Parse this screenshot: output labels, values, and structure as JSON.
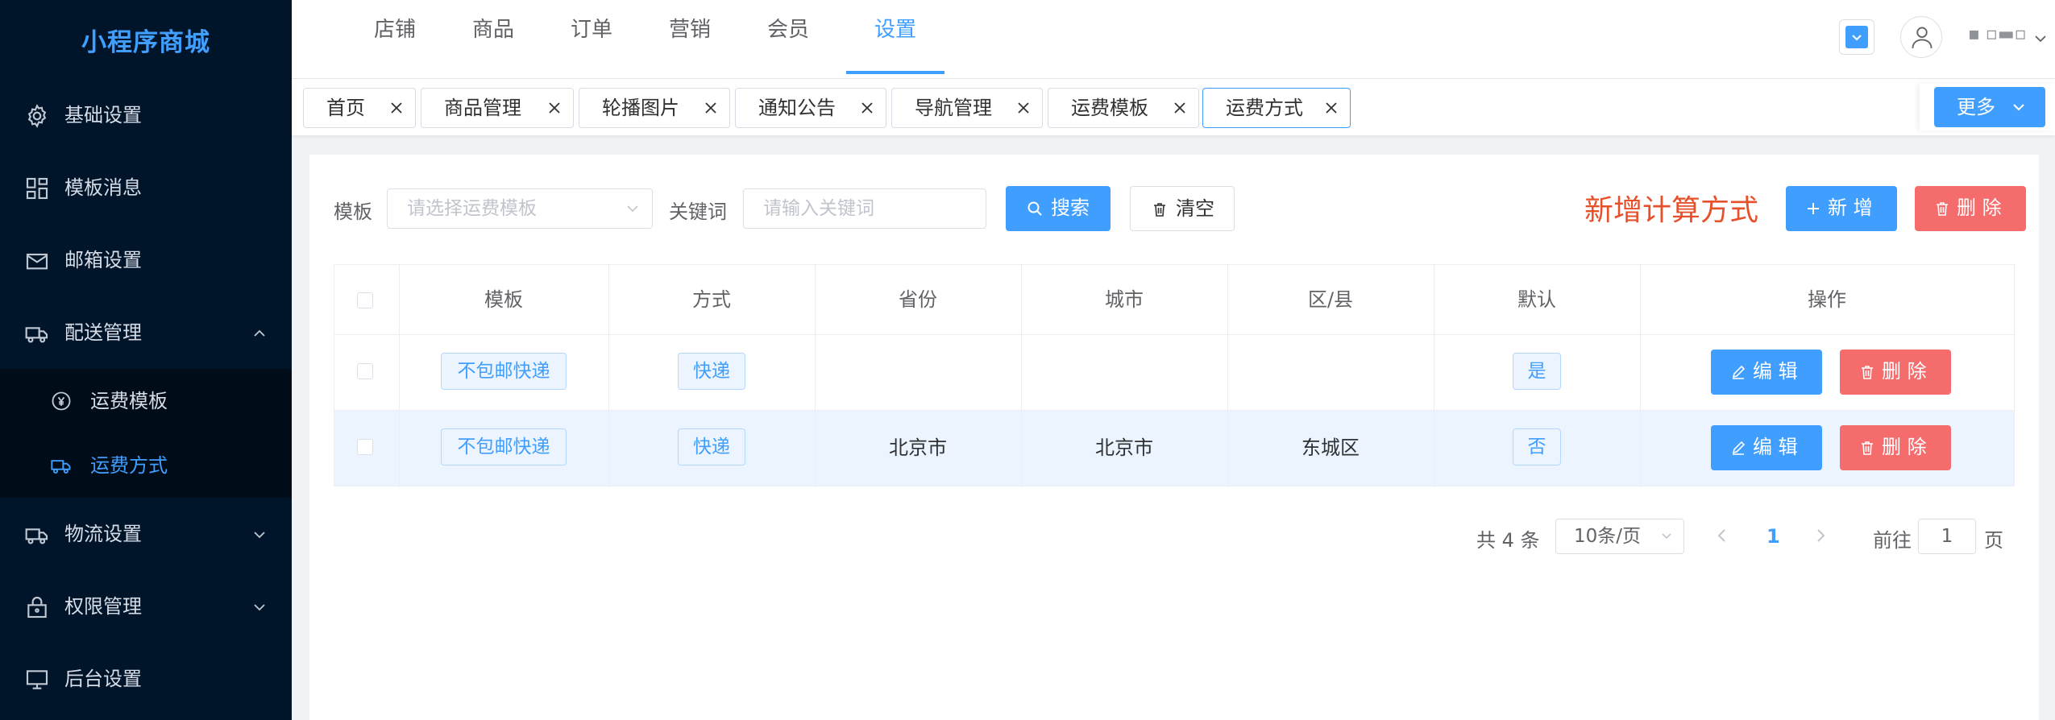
{
  "app": {
    "title": "小程序商城",
    "colors": {
      "primary": "#409eff",
      "danger": "#f56c6c",
      "sidebar_bg": "#001529",
      "promo": "#e6502a"
    }
  },
  "sidebar": {
    "items": [
      {
        "label": "基础设置",
        "icon": "gear-icon"
      },
      {
        "label": "模板消息",
        "icon": "grid-icon"
      },
      {
        "label": "邮箱设置",
        "icon": "mail-icon"
      },
      {
        "label": "配送管理",
        "icon": "delivery-icon",
        "expanded": true
      },
      {
        "label": "物流设置",
        "icon": "truck-icon"
      },
      {
        "label": "权限管理",
        "icon": "lock-icon"
      },
      {
        "label": "后台设置",
        "icon": "monitor-icon"
      }
    ],
    "sub_items": [
      {
        "label": "运费模板",
        "icon": "yen-circle-icon"
      },
      {
        "label": "运费方式",
        "icon": "van-icon",
        "active": true
      }
    ]
  },
  "topnav": {
    "items": [
      "店铺",
      "商品",
      "订单",
      "营销",
      "会员",
      "设置"
    ],
    "active": "设置",
    "user": {
      "name": "▪ ▫▬▫"
    }
  },
  "tabs": {
    "items": [
      "首页",
      "商品管理",
      "轮播图片",
      "通知公告",
      "导航管理",
      "运费模板",
      "运费方式"
    ],
    "active": "运费方式",
    "more_label": "更多"
  },
  "filters": {
    "template_label": "模板",
    "template_placeholder": "请选择运费模板",
    "keyword_label": "关键词",
    "keyword_placeholder": "请输入关键词",
    "search_label": "搜索",
    "clear_label": "清空"
  },
  "actions": {
    "promo_text": "新增计算方式",
    "add_label": "新 增",
    "delete_label": "删 除"
  },
  "table": {
    "columns": [
      "模板",
      "方式",
      "省份",
      "城市",
      "区/县",
      "默认",
      "操作"
    ],
    "rows": [
      {
        "template": "不包邮快递",
        "method": "快递",
        "province": "",
        "city": "",
        "district": "",
        "default": "是",
        "edit": "编 辑",
        "delete": "删 除"
      },
      {
        "template": "不包邮快递",
        "method": "快递",
        "province": "北京市",
        "city": "北京市",
        "district": "东城区",
        "default": "否",
        "edit": "编 辑",
        "delete": "删 除"
      }
    ]
  },
  "pagination": {
    "total_text": "共 4 条",
    "page_size": "10条/页",
    "current_page": "1",
    "goto_label": "前往",
    "goto_value": "1",
    "page_suffix": "页"
  }
}
